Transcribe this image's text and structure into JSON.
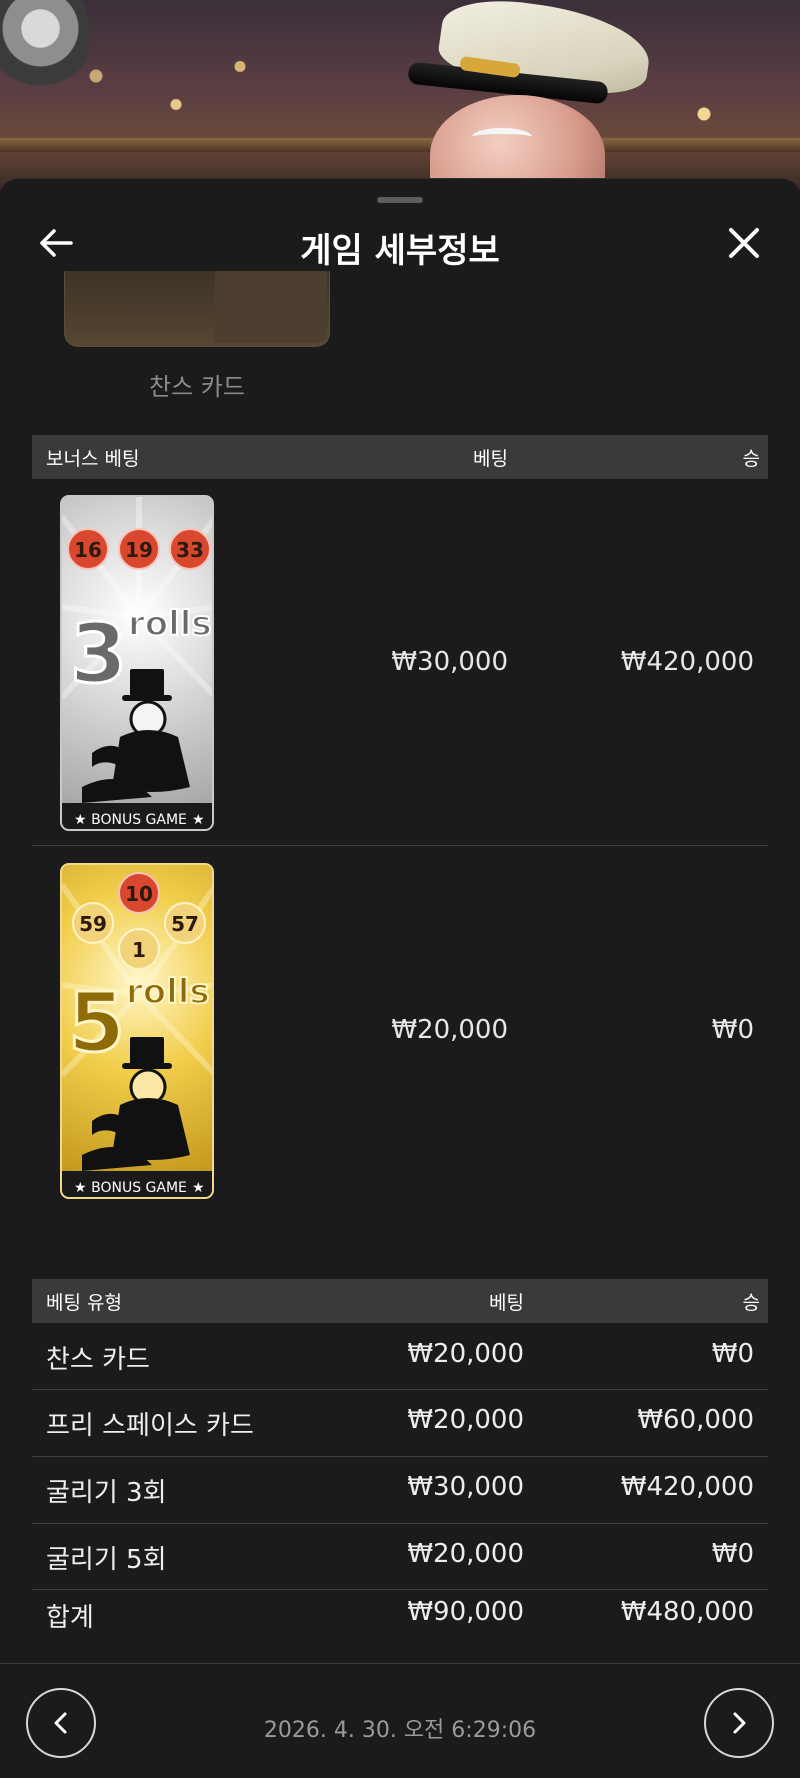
{
  "header": {
    "title": "게임 세부정보"
  },
  "chance_card": {
    "label": "찬스 카드"
  },
  "bonus_table": {
    "columns": [
      "보너스 베팅",
      "베팅",
      "승"
    ],
    "rows": [
      {
        "tile": {
          "balls": [
            "16",
            "19",
            "33"
          ],
          "number": "3",
          "word": "rolls",
          "footer": "BONUS GAME",
          "style": "silver"
        },
        "bet": "₩30,000",
        "win": "₩420,000"
      },
      {
        "tile": {
          "balls": [
            "10",
            "59",
            "57",
            "1"
          ],
          "number": "5",
          "word": "rolls",
          "footer": "BONUS GAME",
          "style": "gold"
        },
        "bet": "₩20,000",
        "win": "₩0"
      }
    ]
  },
  "bet_type_table": {
    "columns": [
      "베팅 유형",
      "베팅",
      "승"
    ],
    "rows": [
      {
        "type": "찬스 카드",
        "bet": "₩20,000",
        "win": "₩0"
      },
      {
        "type": "프리 스페이스 카드",
        "bet": "₩20,000",
        "win": "₩60,000"
      },
      {
        "type": "굴리기 3회",
        "bet": "₩30,000",
        "win": "₩420,000"
      },
      {
        "type": "굴리기 5회",
        "bet": "₩20,000",
        "win": "₩0"
      }
    ],
    "total": {
      "label": "합계",
      "bet": "₩90,000",
      "win": "₩480,000"
    }
  },
  "footer": {
    "timestamp": "2026. 4. 30. 오전 6:29:06"
  },
  "icons": {
    "back": "arrow-left-icon",
    "close": "close-icon",
    "prev": "chevron-left-icon",
    "next": "chevron-right-icon"
  },
  "colors": {
    "sheet": "#1b1b1b",
    "table_header": "#3a3a3a",
    "ball_red": "#d9472f",
    "ball_gold": "#f0c85a"
  }
}
